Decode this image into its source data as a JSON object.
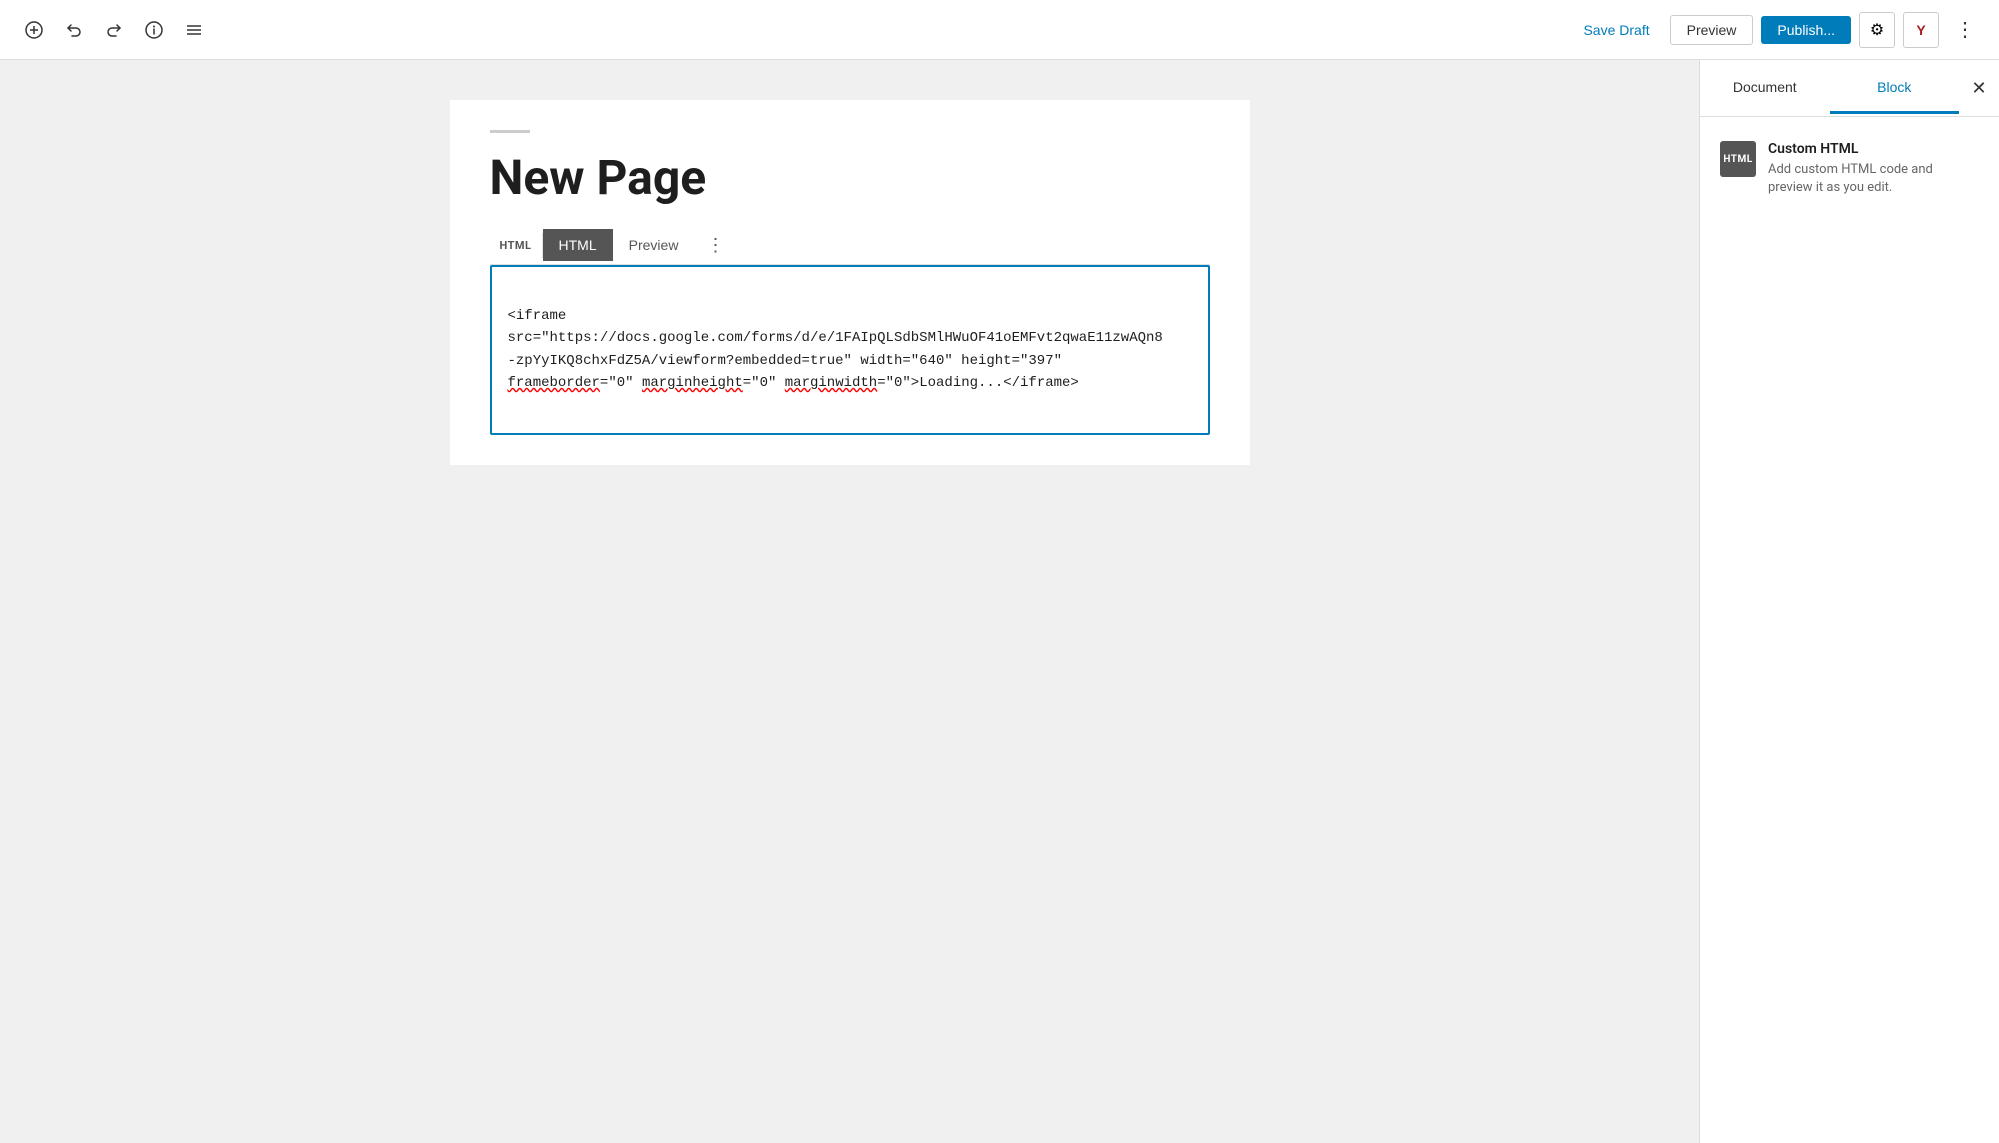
{
  "toolbar": {
    "save_draft_label": "Save Draft",
    "preview_label": "Preview",
    "publish_label": "Publish...",
    "settings_icon": "⚙",
    "yoast_icon": "Y",
    "more_icon": "⋮"
  },
  "editor": {
    "page_title": "New Page",
    "html_badge": "HTML",
    "html_tab_label": "HTML",
    "preview_tab_label": "Preview",
    "more_tab_icon": "⋮",
    "code_content": "<iframe\nsrc=\"https://docs.google.com/forms/d/e/1FAIpQLSdbSMlHWuOF41oEMFvt2qwaE11zwAQn8\n-zpYyIKQ8chxFdZ5A/viewform?embedded=true\" width=\"640\" height=\"397\"\nframeborder=\"0\" marginheight=\"0\" marginwidth=\"0\">Loading...</iframe>"
  },
  "sidebar": {
    "document_tab": "Document",
    "block_tab": "Block",
    "close_icon": "✕",
    "block_type_icon_label": "HTML",
    "block_type_title": "Custom HTML",
    "block_type_description": "Add custom HTML code and preview it as you edit."
  }
}
